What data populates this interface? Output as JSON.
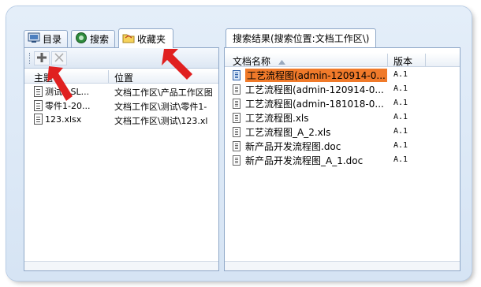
{
  "left_tabs": [
    {
      "label": "目录",
      "icon": "catalog-icon"
    },
    {
      "label": "搜索",
      "icon": "search-icon"
    },
    {
      "label": "收藏夹",
      "icon": "folder-icon"
    }
  ],
  "left_toolbar": {
    "add": "add-icon",
    "remove": "delete-icon"
  },
  "left_columns": [
    "主题",
    "位置"
  ],
  "left_rows": [
    {
      "subject": "测试1.SL...",
      "location": "文档工作区\\产品工作区图"
    },
    {
      "subject": "零件1-20...",
      "location": "文档工作区\\测试\\零件1-"
    },
    {
      "subject": "123.xlsx",
      "location": "文档工作区\\测试\\123.xl"
    }
  ],
  "right_tab": "搜索结果(搜索位置:文档工作区\\)",
  "right_columns": [
    "文档名称",
    "版本"
  ],
  "right_rows": [
    {
      "name": "工艺流程图(admin-120914-0...",
      "version": "A.1",
      "selected": true
    },
    {
      "name": "工艺流程图(admin-120914-0...",
      "version": "A.1"
    },
    {
      "name": "工艺流程图(admin-181018-0...",
      "version": "A.1"
    },
    {
      "name": "工艺流程图.xls",
      "version": "A.1"
    },
    {
      "name": "工艺流程图_A_2.xls",
      "version": "A.1"
    },
    {
      "name": "新产品开发流程图.doc",
      "version": "A.1"
    },
    {
      "name": "新产品开发流程图_A_1.doc",
      "version": "A.1"
    }
  ],
  "colors": {
    "selection": "#f07a2a",
    "arrow": "#e02020",
    "frame": "#d6e4f4"
  }
}
